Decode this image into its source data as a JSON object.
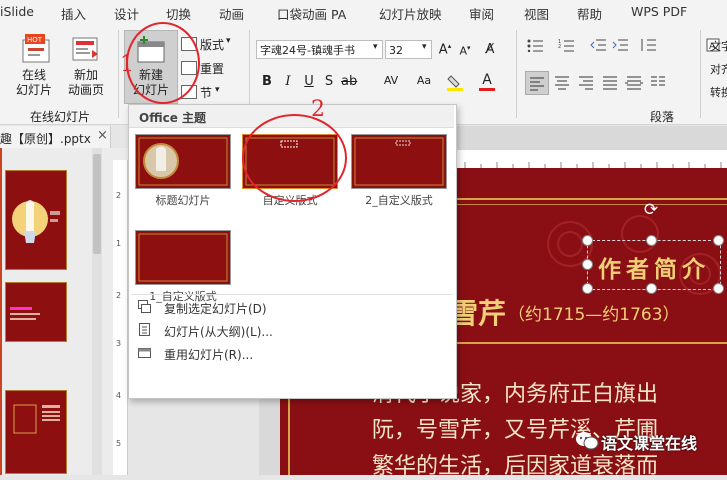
{
  "menubar": {
    "items": [
      "iSlide",
      "插入",
      "设计",
      "切换",
      "动画",
      "口袋动画 PA",
      "幻灯片放映",
      "审阅",
      "视图",
      "帮助",
      "WPS PDF"
    ]
  },
  "ribbon": {
    "online_slides_btn": "在线\n幻灯片",
    "new_animation_page_btn": "新加\n动画页",
    "group_online_slides": "在线幻灯片",
    "new_slide_btn": "新建\n幻灯片",
    "layout_btn": "版式",
    "reset_btn": "重置",
    "section_btn": "节",
    "font_name": "字魂24号-镇魂手书",
    "font_size": "32",
    "group_paragraph": "段落",
    "text_direction_btn": "文字",
    "align_text_btn": "对齐",
    "convert_btn": "转换"
  },
  "doc_tab": {
    "title": "趣【原创】.pptx"
  },
  "dropdown": {
    "section_title": "Office 主题",
    "layouts": [
      {
        "label": "标题幻灯片"
      },
      {
        "label": "自定义版式"
      },
      {
        "label": "2_自定义版式"
      },
      {
        "label": "1_自定义版式"
      }
    ],
    "commands": [
      {
        "label": "复制选定幻灯片(D)"
      },
      {
        "label": "幻灯片(从大纲)(L)..."
      },
      {
        "label": "重用幻灯片(R)..."
      }
    ]
  },
  "annotations": {
    "marker_1": "1",
    "marker_2": "2"
  },
  "slide": {
    "title_box": "作者简介",
    "name_text": "雪芹",
    "years_text": "（约1715—约1763）",
    "body_line_1": "清代小说家，内务府正白旗出",
    "body_line_2": "阮，号雪芹，又号芹溪、芹圃",
    "body_line_3": "繁华的生活，后因家道衰落而"
  },
  "watermark": {
    "text": "语文课堂在线"
  },
  "colors": {
    "slide_red": "#8a0f14",
    "gold": "#e8c060",
    "annotation_red": "#e0262c"
  }
}
